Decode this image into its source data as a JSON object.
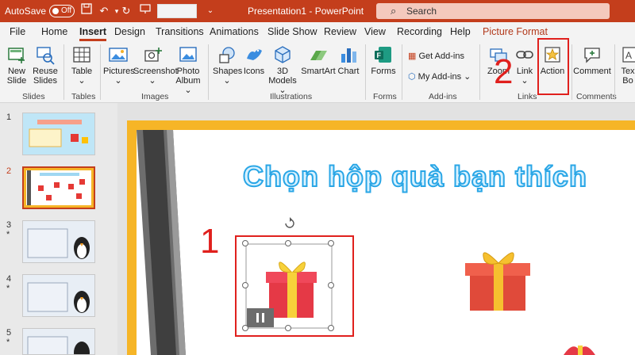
{
  "titlebar": {
    "autosave_label": "AutoSave",
    "autosave_state": "Off",
    "doc_title": "Presentation1  -  PowerPoint",
    "search_placeholder": "Search"
  },
  "tabs": [
    {
      "label": "File"
    },
    {
      "label": "Home"
    },
    {
      "label": "Insert"
    },
    {
      "label": "Design"
    },
    {
      "label": "Transitions"
    },
    {
      "label": "Animations"
    },
    {
      "label": "Slide Show"
    },
    {
      "label": "Review"
    },
    {
      "label": "View"
    },
    {
      "label": "Recording"
    },
    {
      "label": "Help"
    },
    {
      "label": "Picture Format"
    }
  ],
  "ribbon": {
    "new_slide": "New\nSlide",
    "reuse_slides": "Reuse\nSlides",
    "table": "Table",
    "pictures": "Pictures",
    "screenshot": "Screenshot",
    "photo_album": "Photo\nAlbum",
    "shapes": "Shapes",
    "icons": "Icons",
    "models_3d": "3D\nModels",
    "smartart": "SmartArt",
    "chart": "Chart",
    "forms": "Forms",
    "get_addins": "Get Add-ins",
    "my_addins": "My Add-ins",
    "zoom": "Zoom",
    "link": "Link",
    "action": "Action",
    "comment": "Comment",
    "textbox": "Tex\nBo",
    "groups": {
      "slides": "Slides",
      "tables": "Tables",
      "images": "Images",
      "illustrations": "Illustrations",
      "forms": "Forms",
      "addins": "Add-ins",
      "links": "Links",
      "comments": "Comments"
    }
  },
  "thumbnails": [
    {
      "num": "1"
    },
    {
      "num": "2"
    },
    {
      "num": "3",
      "star": "*"
    },
    {
      "num": "4",
      "star": "*"
    },
    {
      "num": "5",
      "star": "*"
    }
  ],
  "slide": {
    "title": "Chọn hộp quà bạn thích"
  },
  "annotations": {
    "step1": "1",
    "step2": "2"
  },
  "colors": {
    "accent": "#c43e1c",
    "highlight_red": "#e0201d",
    "slide_frame": "#f6b527"
  }
}
